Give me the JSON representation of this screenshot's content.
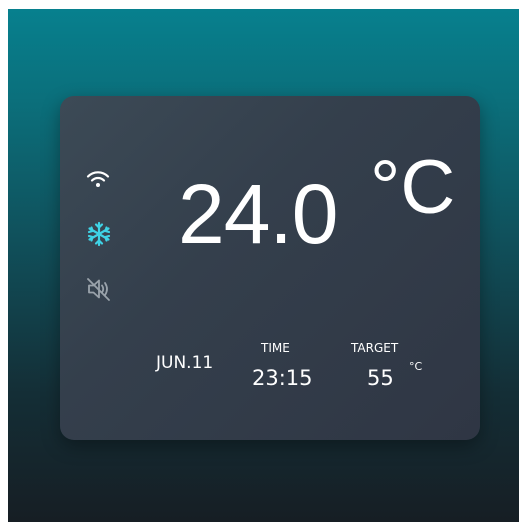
{
  "display": {
    "temperature": "24.0",
    "unit": "°C",
    "date": "JUN.11",
    "time_label": "TIME",
    "time_value": "23:15",
    "target_label": "TARGET",
    "target_value": "55",
    "target_unit": "°C"
  },
  "status_icons": {
    "wifi": "wifi-icon",
    "mode": "snowflake-icon",
    "sound": "speaker-muted-icon"
  },
  "colors": {
    "background_top": "#07808e",
    "background_bottom": "#161e24",
    "panel": "#343f4c",
    "text": "#ffffff",
    "accent_cooling": "#3fd3e6",
    "icon_muted": "#9aa3ab"
  }
}
